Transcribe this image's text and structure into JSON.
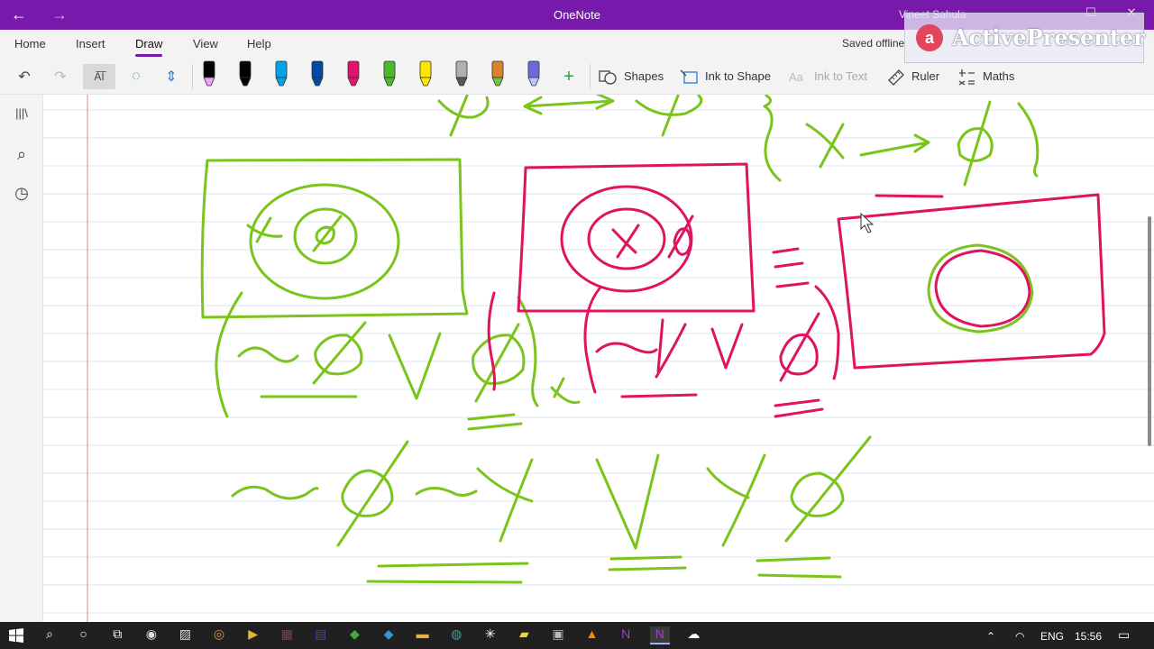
{
  "window": {
    "title": "OneNote",
    "user": "Vineet Sahula",
    "back_icon": "arrow-left-icon",
    "forward_icon": "arrow-right-icon",
    "controls": [
      "—",
      "☐",
      "✕"
    ]
  },
  "ribbon": {
    "tabs": [
      {
        "label": "Home"
      },
      {
        "label": "Insert"
      },
      {
        "label": "Draw",
        "active": true
      },
      {
        "label": "View"
      },
      {
        "label": "Help"
      }
    ],
    "status": "Saved offline"
  },
  "toolbar": {
    "undo_icon": "↶",
    "redo_icon": "↷",
    "type_icon": "A͞I",
    "lasso_icon": "◌",
    "space_icon": "⇕",
    "pens": [
      {
        "color": "#000000",
        "tip": "#f0a0ff"
      },
      {
        "color": "#000000",
        "tip": "#000000"
      },
      {
        "color": "#00a2e8",
        "tip": "#00a2e8"
      },
      {
        "color": "#004a9f",
        "tip": "#004a9f"
      },
      {
        "color": "#e3136a",
        "tip": "#e3136a"
      },
      {
        "color": "#4cb82c",
        "tip": "#4cb82c"
      },
      {
        "color": "#ffe600",
        "tip": "#ffe600"
      },
      {
        "color": "#b0b0b0",
        "tip": "#555555"
      },
      {
        "color": "#d9832f",
        "tip": "#7ac142"
      },
      {
        "color": "#6a6ad9",
        "tip": "#c0c0ff"
      }
    ],
    "add_pen": "+",
    "shapes_label": "Shapes",
    "ink_to_shape_label": "Ink to Shape",
    "ink_to_text_label": "Ink to Text",
    "ruler_label": "Ruler",
    "maths_label": "Maths"
  },
  "sidebar": {
    "items": [
      {
        "icon": "notebooks-icon",
        "glyph": "|||\\"
      },
      {
        "icon": "search-icon",
        "glyph": "⌕"
      },
      {
        "icon": "recent-clock-icon",
        "glyph": "◷"
      }
    ]
  },
  "canvas": {
    "ink_green": "#7ac41b",
    "ink_magenta": "#e0145e",
    "margin_line": "#e38a8a",
    "rule_line": "#dbe5f1"
  },
  "watermark": {
    "text": "ActivePresenter",
    "logo": "a"
  },
  "taskbar": {
    "icons": [
      "start-icon",
      "search-icon",
      "cortana-icon",
      "task-view-icon",
      "chrome-like-icon",
      "photos-icon",
      "browser-icon",
      "media-player-icon",
      "app-red-icon",
      "app-blue-icon",
      "app-green-icon",
      "app-blue2-icon",
      "file-explorer-icon",
      "app-teal-icon",
      "settings-icon",
      "sticky-notes-icon",
      "app-gray-icon",
      "vlc-icon",
      "onenote-icon",
      "onenote-active-icon",
      "app-dark-icon"
    ],
    "language": "ENG",
    "time": "15:56"
  }
}
